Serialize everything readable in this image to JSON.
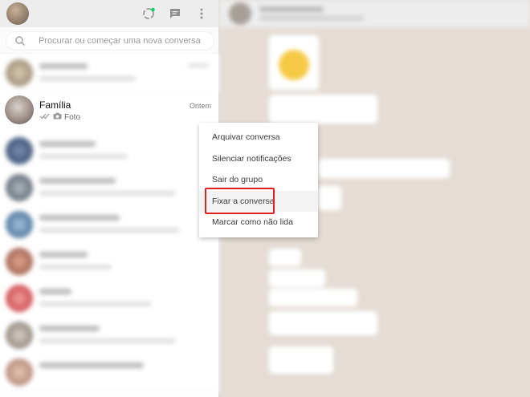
{
  "header": {
    "status_icon": "status-icon",
    "new_chat_icon": "new-chat-icon",
    "menu_icon": "menu-icon"
  },
  "search": {
    "placeholder": "Procurar ou começar uma nova conversa"
  },
  "focused_chat": {
    "name": "Família",
    "time": "Ontem",
    "preview": "Foto"
  },
  "context_menu": {
    "items": [
      "Arquivar conversa",
      "Silenciar notificações",
      "Sair do grupo",
      "Fixar a conversa",
      "Marcar como não lida"
    ],
    "highlighted_index": 3
  },
  "colors": {
    "highlight_border": "#e02020",
    "chat_background": "#e5ddd5",
    "header": "#ededed"
  }
}
